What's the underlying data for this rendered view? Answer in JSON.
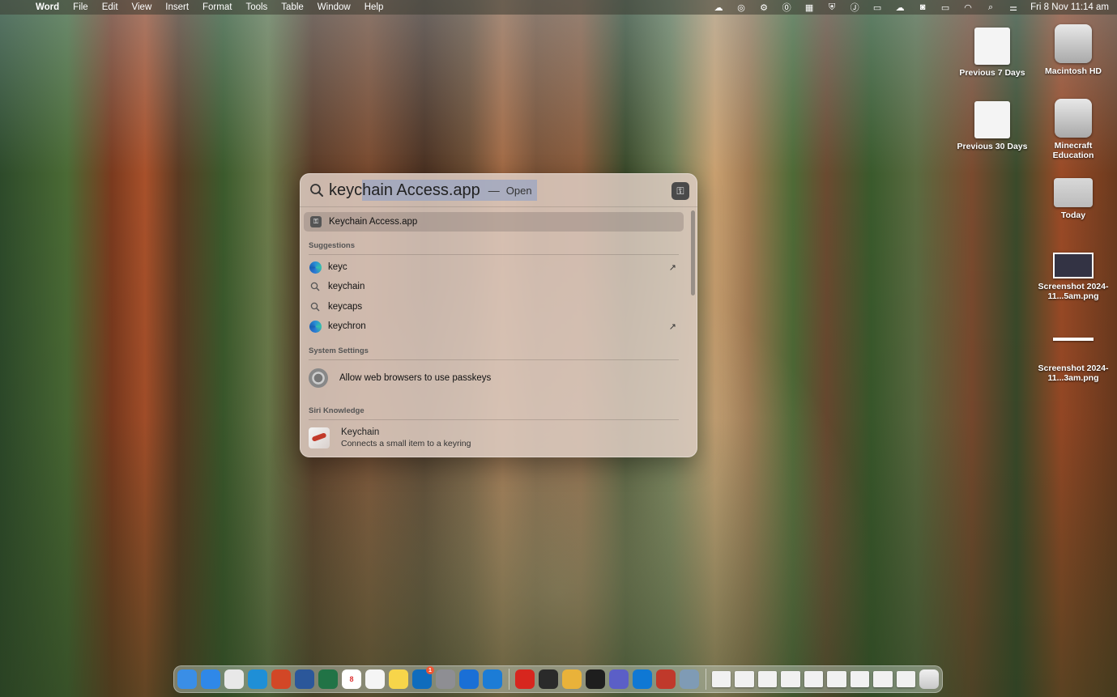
{
  "menubar": {
    "app_name": "Word",
    "items": [
      "File",
      "Edit",
      "View",
      "Insert",
      "Format",
      "Tools",
      "Table",
      "Window",
      "Help"
    ],
    "clock": "Fri 8 Nov  11:14 am",
    "status_icons": [
      "onedrive-icon",
      "creative-cloud-icon",
      "app-store-icon",
      "1password-icon",
      "windows-app-icon",
      "shield-icon",
      "user-j-icon",
      "keyboard-icon",
      "cloud-sync-icon",
      "outlook-icon",
      "battery-icon",
      "wifi-icon",
      "search-icon",
      "control-center-icon"
    ]
  },
  "desktop": {
    "icons": [
      {
        "label": "Previous 7 Days",
        "type": "document"
      },
      {
        "label": "Macintosh HD",
        "type": "disk"
      },
      {
        "label": "Previous 30 Days",
        "type": "pdf"
      },
      {
        "label": "Minecraft Education",
        "type": "disk"
      },
      {
        "label": "Today",
        "type": "folder"
      },
      {
        "label": "Screenshot 2024-11...5am.png",
        "type": "screenshot"
      },
      {
        "label": "Screenshot 2024-11...3am.png",
        "type": "screenshot"
      }
    ]
  },
  "spotlight": {
    "query_typed": "keyc",
    "query_completion": "hain Access.app",
    "action_separator": "—",
    "action_label": "Open",
    "top_hit": "Keychain Access.app",
    "sections": {
      "suggestions_title": "Suggestions",
      "system_settings_title": "System Settings",
      "siri_knowledge_title": "Siri Knowledge"
    },
    "suggestions": [
      {
        "label": "keyc",
        "icon": "edge-icon",
        "arrow": "↗"
      },
      {
        "label": "keychain",
        "icon": "search-icon",
        "arrow": ""
      },
      {
        "label": "keycaps",
        "icon": "search-icon",
        "arrow": ""
      },
      {
        "label": "keychron",
        "icon": "edge-icon",
        "arrow": "↗"
      }
    ],
    "system_setting": "Allow web browsers to use passkeys",
    "siri": {
      "title": "Keychain",
      "subtitle": "Connects a small item to a keyring"
    }
  },
  "dock": {
    "apps": [
      {
        "name": "finder-icon",
        "color": "#3a8ee6"
      },
      {
        "name": "safari-icon",
        "color": "#2f88e8"
      },
      {
        "name": "launchpad-icon",
        "color": "#e8e8e8"
      },
      {
        "name": "edge-icon",
        "color": "#1f8fd6"
      },
      {
        "name": "powerpoint-icon",
        "color": "#d24726"
      },
      {
        "name": "word-icon",
        "color": "#2b579a"
      },
      {
        "name": "excel-icon",
        "color": "#217346"
      },
      {
        "name": "calendar-icon",
        "color": "#ffffff"
      },
      {
        "name": "reminders-icon",
        "color": "#f5f5f5"
      },
      {
        "name": "notes-icon",
        "color": "#f7d54a"
      },
      {
        "name": "outlook-icon",
        "color": "#0f6cbd"
      },
      {
        "name": "system-settings-icon",
        "color": "#8e8e93"
      },
      {
        "name": "1password-icon",
        "color": "#1a6fd6"
      },
      {
        "name": "windows-app-icon",
        "color": "#1c7cd6"
      },
      {
        "name": "acrobat-icon",
        "color": "#d7261e"
      },
      {
        "name": "terminal-dark-icon",
        "color": "#2a2a2a"
      },
      {
        "name": "chrome-icon",
        "color": "#e9b23a"
      },
      {
        "name": "terminal-icon",
        "color": "#1e1e1e"
      },
      {
        "name": "teams-icon",
        "color": "#5b5fc7"
      },
      {
        "name": "onedrive-icon",
        "color": "#0f78d4"
      },
      {
        "name": "photo-booth-icon",
        "color": "#c0392b"
      },
      {
        "name": "preview-icon",
        "color": "#7f9bb5"
      }
    ],
    "calendar_month": "NOV",
    "calendar_day": "8",
    "outlook_badge": "1",
    "documents_count": 9
  }
}
